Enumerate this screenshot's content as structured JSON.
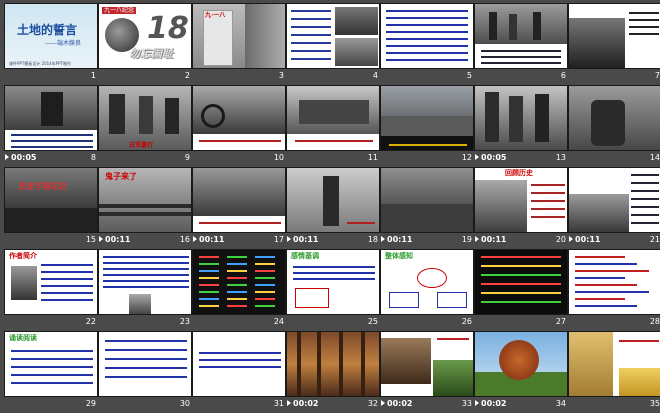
{
  "slides": [
    {
      "num": "1",
      "time": "",
      "title": "土地的誓言",
      "subtitle": "——端木蕻良",
      "footer": "课件PPT模板设计 2014年PPT制作"
    },
    {
      "num": "2",
      "time": "",
      "badge": "九一八纪念",
      "bignum": "18",
      "caption": "勿忘国耻"
    },
    {
      "num": "3",
      "time": "",
      "label": "九·一八"
    },
    {
      "num": "4",
      "time": ""
    },
    {
      "num": "5",
      "time": ""
    },
    {
      "num": "6",
      "time": ""
    },
    {
      "num": "7",
      "time": ""
    },
    {
      "num": "8",
      "time": "00:05"
    },
    {
      "num": "9",
      "time": "",
      "caption": "日军暴行"
    },
    {
      "num": "10",
      "time": ""
    },
    {
      "num": "11",
      "time": ""
    },
    {
      "num": "12",
      "time": ""
    },
    {
      "num": "13",
      "time": "00:05"
    },
    {
      "num": "14",
      "time": ""
    },
    {
      "num": "15",
      "time": "",
      "caption": "历史不容忘记"
    },
    {
      "num": "16",
      "time": "00:11",
      "caption": "鬼子来了"
    },
    {
      "num": "17",
      "time": "00:11"
    },
    {
      "num": "18",
      "time": "00:11"
    },
    {
      "num": "19",
      "time": "00:11"
    },
    {
      "num": "20",
      "time": "00:11",
      "caption": "回顾历史"
    },
    {
      "num": "21",
      "time": "00:11"
    },
    {
      "num": "22",
      "time": "",
      "caption": "作者简介"
    },
    {
      "num": "23",
      "time": ""
    },
    {
      "num": "24",
      "time": ""
    },
    {
      "num": "25",
      "time": "",
      "caption": "感情基调"
    },
    {
      "num": "26",
      "time": "",
      "caption": "整体感知"
    },
    {
      "num": "27",
      "time": ""
    },
    {
      "num": "28",
      "time": ""
    },
    {
      "num": "29",
      "time": "",
      "caption": "诵读阅读"
    },
    {
      "num": "30",
      "time": ""
    },
    {
      "num": "31",
      "time": ""
    },
    {
      "num": "32",
      "time": "00:02"
    },
    {
      "num": "33",
      "time": "00:02"
    },
    {
      "num": "34",
      "time": "00:02"
    },
    {
      "num": "35",
      "time": ""
    }
  ]
}
